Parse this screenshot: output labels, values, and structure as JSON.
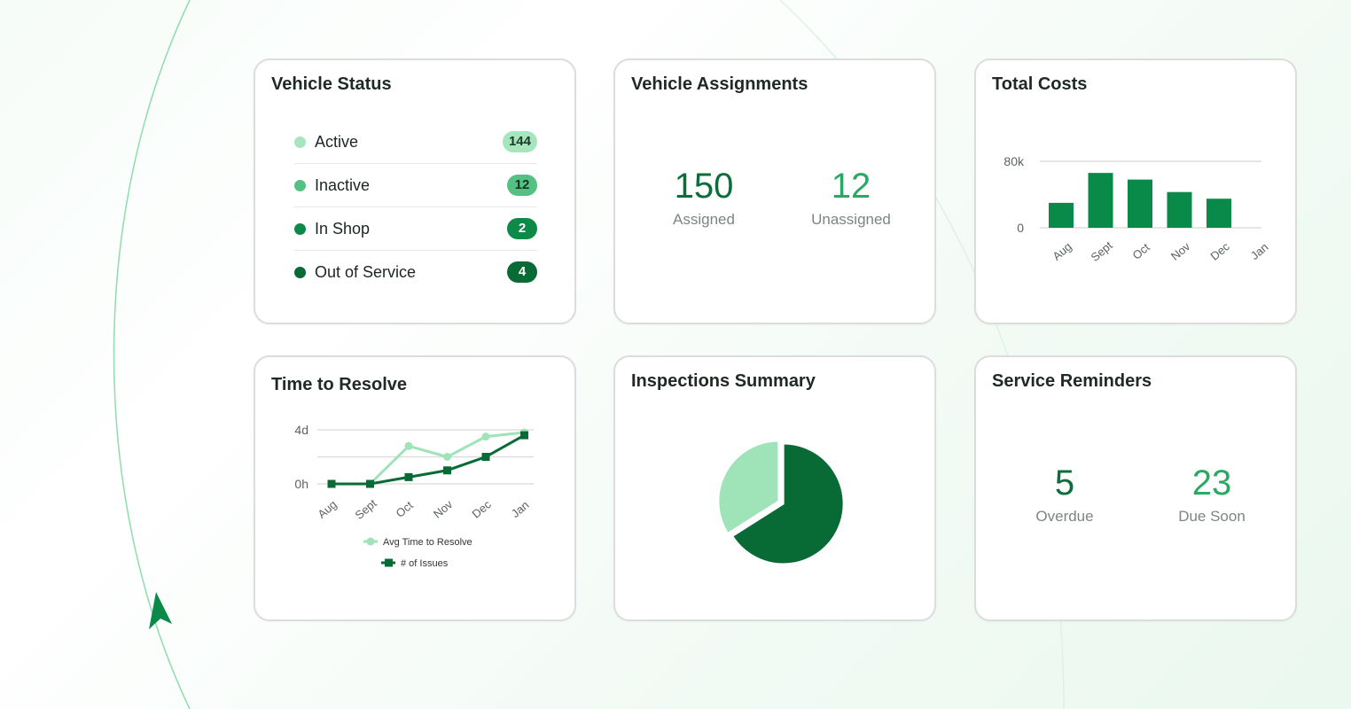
{
  "colors": {
    "light": "#9fe3b9",
    "mid": "#53bd7e",
    "brand": "#0a8a48",
    "dark": "#086a35"
  },
  "vehicle_status": {
    "title": "Vehicle Status",
    "items": [
      {
        "label": "Active",
        "count": "144",
        "dot": "#a6e5be",
        "pill_bg": "#a6e5be",
        "pill_fg": "#1b3b28"
      },
      {
        "label": "Inactive",
        "count": "12",
        "dot": "#55c083",
        "pill_bg": "#55c083",
        "pill_fg": "#123322"
      },
      {
        "label": "In Shop",
        "count": "2",
        "dot": "#0b8a48",
        "pill_bg": "#0b8a48",
        "pill_fg": "#ffffff"
      },
      {
        "label": "Out of Service",
        "count": "4",
        "dot": "#086a35",
        "pill_bg": "#086a35",
        "pill_fg": "#ffffff"
      }
    ]
  },
  "vehicle_assignments": {
    "title": "Vehicle Assignments",
    "assigned": {
      "value": "150",
      "label": "Assigned"
    },
    "unassigned": {
      "value": "12",
      "label": "Unassigned"
    }
  },
  "total_costs": {
    "title": "Total Costs"
  },
  "time_to_resolve": {
    "title": "Time to Resolve"
  },
  "inspections": {
    "title": "Inspections Summary"
  },
  "service_reminders": {
    "title": "Service Reminders",
    "overdue": {
      "value": "5",
      "label": "Overdue"
    },
    "due_soon": {
      "value": "23",
      "label": "Due Soon"
    }
  },
  "chart_data": [
    {
      "type": "bar",
      "title": "Total Costs",
      "categories": [
        "Aug",
        "Sept",
        "Oct",
        "Nov",
        "Dec",
        "Jan"
      ],
      "values": [
        30000,
        66000,
        58000,
        43000,
        35000,
        0
      ],
      "yticks": [
        "0",
        "80k"
      ],
      "ylim": [
        0,
        80000
      ],
      "color": "#0a8a48",
      "grid": true
    },
    {
      "type": "line",
      "title": "Time to Resolve",
      "categories": [
        "Aug",
        "Sept",
        "Oct",
        "Nov",
        "Dec",
        "Jan"
      ],
      "yticks": [
        "0h",
        "4d"
      ],
      "ylim": [
        0,
        4
      ],
      "series": [
        {
          "name": "Avg Time to Resolve",
          "values": [
            0,
            0,
            2.8,
            2.0,
            3.5,
            3.8
          ],
          "color": "#9fe3b9",
          "marker": "circle"
        },
        {
          "name": "# of Issues",
          "values": [
            0,
            0,
            0.5,
            1.0,
            2.0,
            3.6
          ],
          "color": "#086a35",
          "marker": "square"
        }
      ],
      "legend": "bottom",
      "grid": true
    },
    {
      "type": "pie",
      "title": "Inspections Summary",
      "slices": [
        {
          "value": 66,
          "color": "#086a35"
        },
        {
          "value": 34,
          "color": "#9fe3b9"
        }
      ]
    }
  ]
}
